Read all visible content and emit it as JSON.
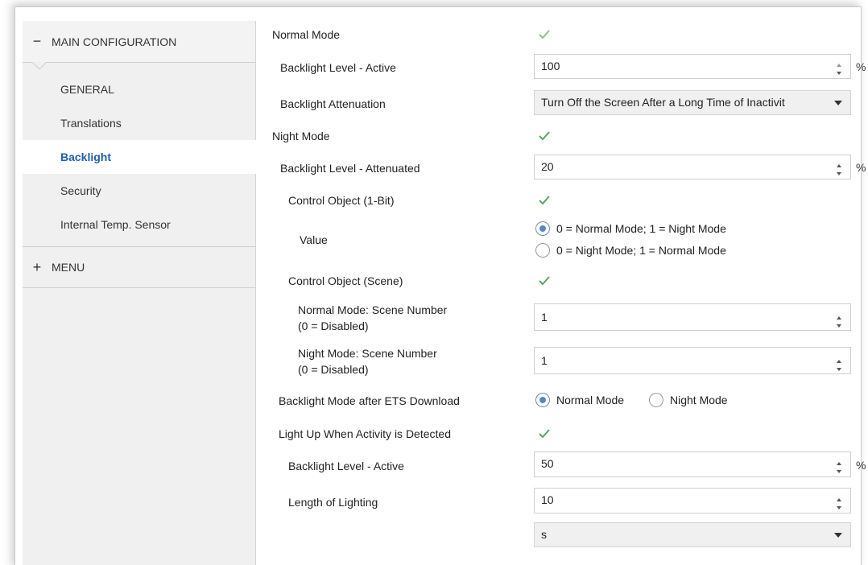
{
  "sidebar": {
    "main_group": {
      "sign": "−",
      "label": "MAIN CONFIGURATION"
    },
    "items": [
      {
        "label": "GENERAL"
      },
      {
        "label": "Translations"
      },
      {
        "label": "Backlight"
      },
      {
        "label": "Security"
      },
      {
        "label": "Internal Temp. Sensor"
      }
    ],
    "active_item": "Backlight",
    "menu_group": {
      "sign": "+",
      "label": "MENU"
    }
  },
  "params": {
    "normal_mode": {
      "label": "Normal Mode",
      "checked": true
    },
    "backlight_level_active": {
      "label": "Backlight Level - Active",
      "value": "100",
      "unit": "%"
    },
    "backlight_attenuation": {
      "label": "Backlight Attenuation",
      "value": "Turn Off the Screen After a Long Time of Inactivit"
    },
    "night_mode": {
      "label": "Night Mode",
      "checked": true
    },
    "backlight_level_attenuated": {
      "label": "Backlight Level - Attenuated",
      "value": "20",
      "unit": "%"
    },
    "control_object_1bit": {
      "label": "Control Object (1-Bit)",
      "checked": true
    },
    "value": {
      "label": "Value",
      "options": [
        "0 = Normal Mode; 1 = Night Mode",
        "0 = Night Mode; 1 = Normal Mode"
      ],
      "selected": 0
    },
    "control_object_scene": {
      "label": "Control Object (Scene)",
      "checked": true
    },
    "normal_scene_number": {
      "label_line1": "Normal Mode: Scene Number",
      "label_line2": "(0 = Disabled)",
      "value": "1"
    },
    "night_scene_number": {
      "label_line1": "Night Mode: Scene Number",
      "label_line2": "(0 = Disabled)",
      "value": "1"
    },
    "mode_after_download": {
      "label": "Backlight Mode after ETS Download",
      "options": [
        "Normal Mode",
        "Night Mode"
      ],
      "selected": 0
    },
    "light_up_activity": {
      "label": "Light Up When Activity is Detected",
      "checked": true
    },
    "backlight_level_active_2": {
      "label": "Backlight Level - Active",
      "value": "50",
      "unit": "%"
    },
    "length_of_lighting": {
      "label": "Length of Lighting",
      "value": "10",
      "unit_select": "s"
    }
  },
  "colors": {
    "check": "#5aa469",
    "active_text": "#1f5fae",
    "radio_fill": "#5b87c0"
  }
}
